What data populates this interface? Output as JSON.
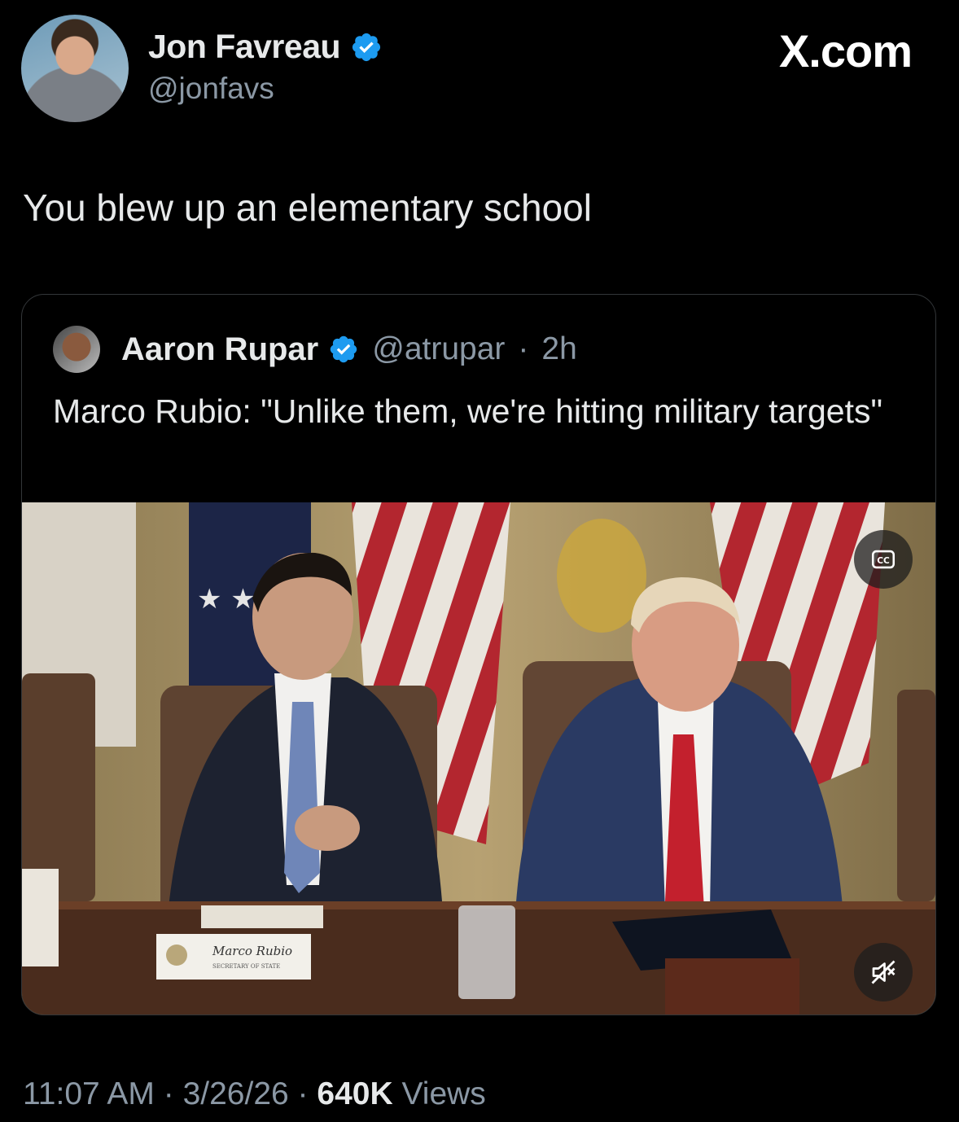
{
  "author": {
    "name": "Jon Favreau",
    "handle": "@jonfavs",
    "verified": true
  },
  "watermark": "X.com",
  "tweet": {
    "text": "You blew up an elementary school"
  },
  "quoted": {
    "name": "Aaron Rupar",
    "handle": "@atrupar",
    "separator": "·",
    "time": "2h",
    "text": "Marco Rubio: \"Unlike them, we're hitting military targets\"",
    "media": {
      "type": "video",
      "nameplate_name": "Marco Rubio",
      "nameplate_title": "SECRETARY OF STATE"
    }
  },
  "meta": {
    "time": "11:07 AM",
    "sep1": "·",
    "date": "3/26/26",
    "sep2": "·",
    "views_count": "640K",
    "views_label": "Views"
  },
  "icons": {
    "verified": "verified-badge-icon",
    "captions": "closed-captions-icon",
    "mute": "muted-speaker-icon"
  },
  "colors": {
    "verified_blue": "#1d9bf0",
    "secondary_text": "#8b98a5"
  }
}
